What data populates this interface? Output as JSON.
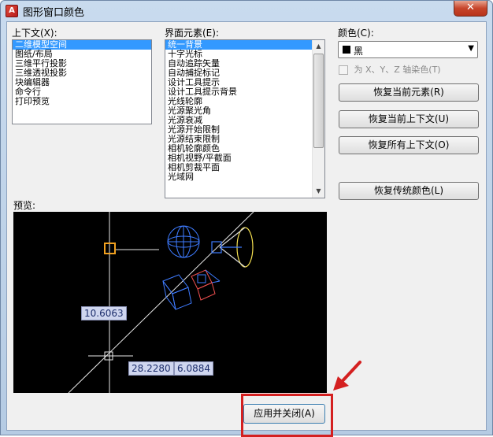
{
  "window": {
    "title": "图形窗口颜色",
    "close_glyph": "✕",
    "app_icon": "autocad-app-icon"
  },
  "context": {
    "label": "上下文(X):",
    "items": [
      "二维模型空间",
      "图纸/布局",
      "三维平行投影",
      "三维透视投影",
      "块编辑器",
      "命令行",
      "打印预览"
    ],
    "selected_index": 0
  },
  "elements": {
    "label": "界面元素(E):",
    "items": [
      "统一背景",
      "十字光标",
      "自动追踪矢量",
      "自动捕捉标记",
      "设计工具提示",
      "设计工具提示背景",
      "光线轮廓",
      "光源聚光角",
      "光源衰减",
      "光源开始限制",
      "光源结束限制",
      "相机轮廓颜色",
      "相机视野/平截面",
      "相机剪裁平面",
      "光域网"
    ],
    "selected_index": 0
  },
  "color": {
    "label": "颜色(C):",
    "value": "黑",
    "swatch_color": "#000000",
    "tint_checkbox_label": "为 X、Y、Z 轴染色(T)",
    "tint_checked": false
  },
  "buttons": {
    "restore_element": "恢复当前元素(R)",
    "restore_context": "恢复当前上下文(U)",
    "restore_all": "恢复所有上下文(O)",
    "restore_classic": "恢复传统颜色(L)",
    "apply_close": "应用并关闭(A)"
  },
  "preview": {
    "label": "预览:",
    "dims": [
      "10.6063",
      "28.2280",
      "6.0884"
    ]
  },
  "annotation": {
    "highlight_color": "#d42020"
  }
}
